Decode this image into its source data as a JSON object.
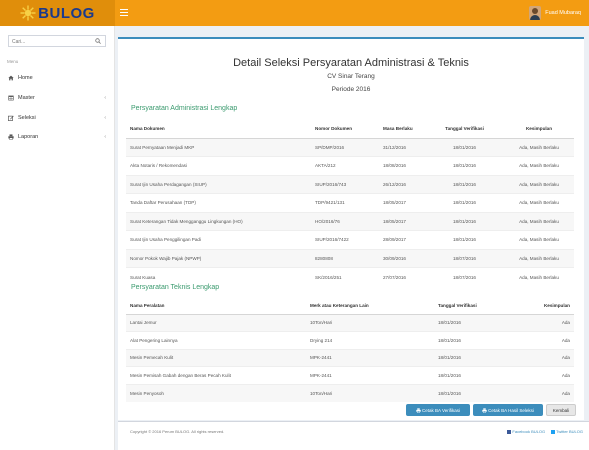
{
  "header": {
    "logo_text": "BULOG",
    "user_name": "Fuad Mubaraq"
  },
  "sidebar": {
    "search_placeholder": "Cari...",
    "nav_header": "Menu",
    "items": [
      {
        "label": "Home",
        "icon": "home-icon"
      },
      {
        "label": "Master",
        "icon": "table-icon"
      },
      {
        "label": "Seleksi",
        "icon": "edit-icon"
      },
      {
        "label": "Laporan",
        "icon": "print-icon"
      }
    ]
  },
  "main": {
    "title": "Detail Seleksi Persyaratan Administrasi & Teknis",
    "company": "CV Sinar Terang",
    "period": "Periode 2016",
    "admin": {
      "section_title": "Persyaratan Administrasi Lengkap",
      "headers": [
        "Nama Dokumen",
        "Nomor Dokumen",
        "Masa Berlaku",
        "Tanggal Verifikasi",
        "Kesimpulan"
      ],
      "rows": [
        [
          "Surat Pernyataan Menjadi MKP",
          "SP/DMP/2016",
          "31/12/2016",
          "18/01/2016",
          "Ada, Masih Berlaku"
        ],
        [
          "Akta Notaris / Rekomendasi",
          "AKTA/212",
          "18/08/2016",
          "18/01/2016",
          "Ada, Masih Berlaku"
        ],
        [
          "Surat Ijin Usaha Perdagangan (SIUP)",
          "SIUP/2016/743",
          "26/12/2016",
          "18/01/2016",
          "Ada, Masih Berlaku"
        ],
        [
          "Tanda Daftar Perusahaan (TDP)",
          "TDP/9421/131",
          "18/05/2017",
          "18/01/2016",
          "Ada, Masih Berlaku"
        ],
        [
          "Surat Keterangan Tidak Mengganggu Lingkungan (HO)",
          "HO/2016/76",
          "18/05/2017",
          "18/01/2016",
          "Ada, Masih Berlaku"
        ],
        [
          "Surat Ijin Usaha Penggilingan Padi",
          "SIUP/2016/7422",
          "28/09/2017",
          "18/01/2016",
          "Ada, Masih Berlaku"
        ],
        [
          "Nomor Pokok Wajib Pajak (NPWP)",
          "8280808",
          "30/09/2016",
          "18/07/2016",
          "Ada, Masih Berlaku"
        ],
        [
          "Surat Kuasa",
          "SK/2016/251",
          "27/07/2016",
          "18/07/2016",
          "Ada, Masih Berlaku"
        ]
      ]
    },
    "teknis": {
      "section_title": "Persyaratan Teknis Lengkap",
      "headers": [
        "Nama Peralatan",
        "Merk atau Keterangan Lain",
        "Tanggal Verifikasi",
        "Kesimpulan"
      ],
      "rows": [
        [
          "Lantai Jemur",
          "10Ton/Hari",
          "18/01/2016",
          "Ada"
        ],
        [
          "Alat Pengering Lainnya",
          "Drying 214",
          "18/01/2016",
          "Ada"
        ],
        [
          "Mesin Pemecah Kulit",
          "MPK-2441",
          "18/01/2016",
          "Ada"
        ],
        [
          "Mesin Pemisah Gabah dengan Beras Pecah Kulit",
          "MPK-2441",
          "18/01/2016",
          "Ada"
        ],
        [
          "Mesin Penyosoh",
          "10Ton/Hari",
          "18/01/2016",
          "Ada"
        ]
      ]
    },
    "buttons": {
      "cetak_ba": "Cetak BA Verifikasi",
      "cetak_hasil": "Cetak BA Hasil Seleksi",
      "kembali": "Kembali"
    }
  },
  "footer": {
    "copyright": "Copyright © 2016 Perum BULOG. All rights reserved.",
    "link1": "Facebook BULOG",
    "link2": "Twitter BULOG"
  },
  "colors": {
    "header": "#f39c12",
    "logo_bg": "#e08e0b",
    "accent": "#3c8dbc",
    "section_title": "#3a9a6e"
  }
}
